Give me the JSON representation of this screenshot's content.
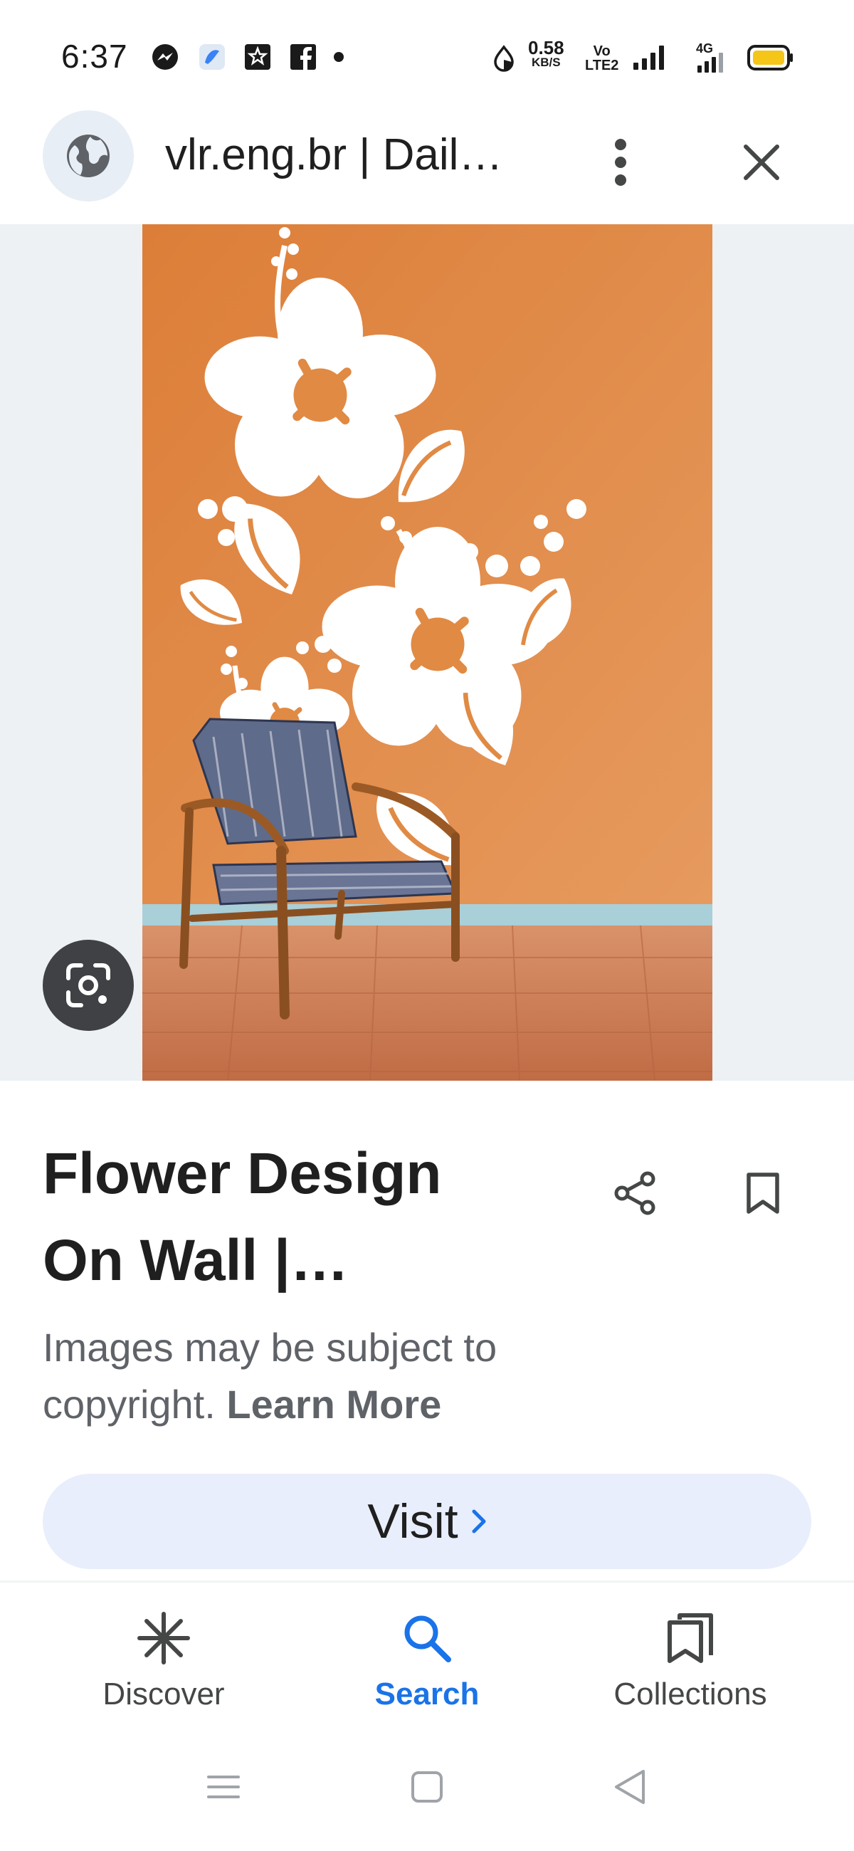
{
  "status_bar": {
    "time": "6:37",
    "net_speed_value": "0.58",
    "net_speed_unit": "KB/S",
    "volte_top": "Vo",
    "volte_bottom": "LTE2",
    "network_type": "4G",
    "icons": [
      "messenger-icon",
      "app-icon",
      "star-box-icon",
      "facebook-icon",
      "dot-icon",
      "data-saver-icon",
      "signal-icon",
      "signal-4g-icon",
      "battery-icon"
    ]
  },
  "top_bar": {
    "site_title": "vlr.eng.br | Dail…",
    "globe_icon": "globe-icon",
    "more_icon": "more-vertical-icon",
    "close_icon": "close-icon"
  },
  "image": {
    "subject": "white hibiscus flower decal on orange wall with armchair",
    "lens_icon": "google-lens-icon"
  },
  "details": {
    "title_line1": "Flower Design",
    "title_line2": "On Wall |…",
    "copyright_text": "Images may be subject to copyright.",
    "learn_more": "Learn More",
    "share_icon": "share-icon",
    "bookmark_icon": "bookmark-icon",
    "visit_label": "Visit"
  },
  "bottom_nav": {
    "items": [
      {
        "label": "Discover",
        "icon": "asterisk-icon",
        "active": false
      },
      {
        "label": "Search",
        "icon": "search-icon",
        "active": true
      },
      {
        "label": "Collections",
        "icon": "collections-icon",
        "active": false
      }
    ]
  },
  "colors": {
    "accent": "#1a73e8",
    "wall": "#e08a44",
    "floor": "#c9825a",
    "visit_bg": "#e8eefb",
    "lens_bg": "#3f4144"
  }
}
